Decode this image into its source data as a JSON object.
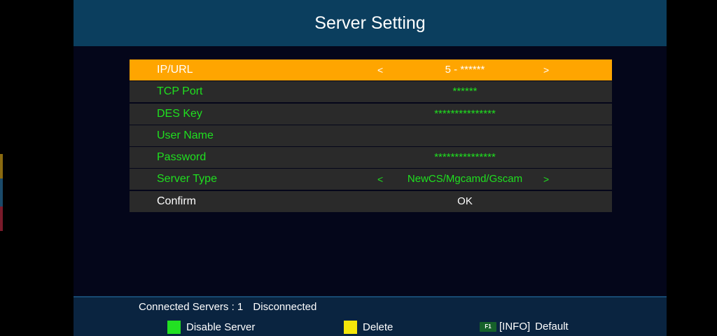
{
  "title": "Server Setting",
  "colors": {
    "selected_row": "#ffa500",
    "field_text": "#1fe01f",
    "header_bg": "#0b3e5e",
    "green_key": "#22e022",
    "yellow_key": "#f5e60a"
  },
  "fields": [
    {
      "label": "IP/URL",
      "value": "5 - ******",
      "arrow_left": "<",
      "arrow_right": ">"
    },
    {
      "label": "TCP Port",
      "value": "******"
    },
    {
      "label": "DES Key",
      "value": "***************"
    },
    {
      "label": "User Name",
      "value": ""
    },
    {
      "label": "Password",
      "value": "***************"
    },
    {
      "label": "Server Type",
      "value": "NewCS/Mgcamd/Gscam",
      "arrow_left": "<",
      "arrow_right": ">"
    },
    {
      "label": "Confirm",
      "value": "OK"
    }
  ],
  "footer": {
    "connected_label": "Connected Servers : 1",
    "connection_status": "Disconnected",
    "keys": [
      {
        "icon": "green-key-icon",
        "label": "Disable Server"
      },
      {
        "icon": "yellow-key-icon",
        "label": "Delete"
      },
      {
        "icon": "f1-key-icon",
        "key_text": "F1",
        "label": "[INFO]",
        "action": "Default"
      }
    ]
  }
}
